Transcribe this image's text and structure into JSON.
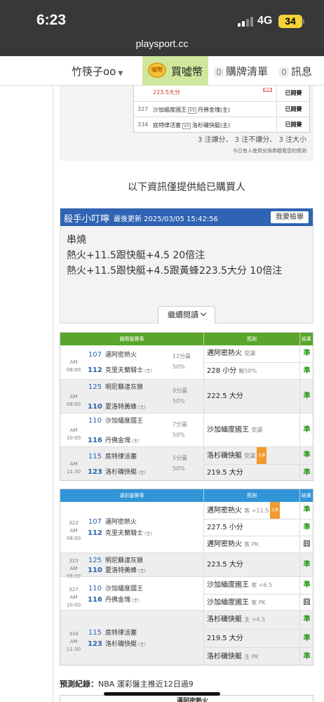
{
  "status": {
    "time": "6:23",
    "network": "4G",
    "battery": "34"
  },
  "url": "playsport.cc",
  "nav": {
    "username": "竹筷子oo",
    "coin_icon_text": "噓幣",
    "coin_label": "買噓幣",
    "cart_count": "0",
    "cart_label": "購牌清單",
    "msg_count": "0",
    "msg_label": "訊息"
  },
  "top_card": {
    "rows": [
      {
        "no": "",
        "teams": "223.5大分",
        "result": "已開賽",
        "red": true
      },
      {
        "no": "327",
        "home": "沙加緬度國王",
        "away": "丹佛金塊(主)",
        "result": "已開賽"
      },
      {
        "no": "334",
        "home": "底特律活塞",
        "away": "洛杉磯快艇(主)",
        "result": "已開賽"
      }
    ],
    "vs": "VS",
    "summary": "3 注讓分、 3 注不讓分、 3 注大小",
    "note": "今日有人使用兌換券觀看您的預測"
  },
  "notice": "以下資訊僅提供給已購買人",
  "killer": {
    "title": "殺手小叮嚀",
    "updated": "最後更新 2025/03/05 15:42:56",
    "report_btn": "我要檢舉",
    "lines": [
      "串燒",
      "熱火+11.5跟快艇+4.5 20倍注",
      "熱火+11.5跟快艇+4.5跟黃蜂223.5大分 10倍注"
    ],
    "more": "繼續閱讀"
  },
  "intl_table": {
    "headers": [
      "國際盤賽事",
      "預測",
      "結果"
    ],
    "games": [
      {
        "time": "AM 08:00",
        "away_no": "107",
        "away": "邁阿密熱火",
        "home_no": "112",
        "home": "克里夫蘭騎士",
        "odds1": "12分贏",
        "odds2": "50%",
        "picks": [
          {
            "text": "邁阿密熱火",
            "sub": "受讓",
            "result": "準"
          },
          {
            "text": "228 小分",
            "sub": "輸50%",
            "result": "準"
          }
        ]
      },
      {
        "time": "AM 08:00",
        "away_no": "125",
        "away": "明尼蘇達灰狼",
        "home_no": "110",
        "home": "夏洛特黃蜂",
        "odds1": "9分贏",
        "odds2": "50%",
        "picks": [
          {
            "text": "222.5 大分",
            "sub": "",
            "result": "準"
          }
        ]
      },
      {
        "time": "AM 10:00",
        "away_no": "110",
        "away": "沙加緬度國王",
        "home_no": "116",
        "home": "丹佛金塊",
        "odds1": "7分贏",
        "odds2": "50%",
        "picks": [
          {
            "text": "沙加緬度國王",
            "sub": "受讓",
            "result": "準"
          }
        ]
      },
      {
        "time": "AM 11:30",
        "away_no": "115",
        "away": "底特律活塞",
        "home_no": "123",
        "home": "洛杉磯快艇",
        "odds1": "5分贏",
        "odds2": "50%",
        "picks": [
          {
            "text": "洛杉磯快艇",
            "sub": "受讓",
            "tag": "主推",
            "result": "準"
          },
          {
            "text": "219.5 大分",
            "sub": "",
            "result": "準"
          }
        ]
      }
    ]
  },
  "lottery_table": {
    "headers": [
      "運彩盤賽事",
      "預測",
      "結果"
    ],
    "games": [
      {
        "no": "322",
        "time": "AM 08:00",
        "away_no": "107",
        "away": "邁阿密熱火",
        "home_no": "112",
        "home": "克里夫蘭騎士",
        "picks": [
          {
            "text": "邁阿密熱火",
            "sub": "客 +11.5",
            "tag": "主推",
            "result": "準"
          },
          {
            "text": "227.5 小分",
            "sub": "",
            "result": "準"
          },
          {
            "text": "邁阿密熱火",
            "sub": "客 PK",
            "result": "囧"
          }
        ]
      },
      {
        "no": "323",
        "time": "AM 08:00",
        "away_no": "125",
        "away": "明尼蘇達灰狼",
        "home_no": "110",
        "home": "夏洛特黃蜂",
        "picks": [
          {
            "text": "223.5 大分",
            "sub": "",
            "result": "準"
          }
        ]
      },
      {
        "no": "327",
        "time": "AM 10:00",
        "away_no": "110",
        "away": "沙加緬度國王",
        "home_no": "116",
        "home": "丹佛金塊",
        "picks": [
          {
            "text": "沙加緬度國王",
            "sub": "客 +6.5",
            "result": "準"
          },
          {
            "text": "沙加緬度國王",
            "sub": "客 PK",
            "result": "囧"
          }
        ]
      },
      {
        "no": "334",
        "time": "AM 11:30",
        "away_no": "115",
        "away": "底特律活塞",
        "home_no": "123",
        "home": "洛杉磯快艇",
        "picks": [
          {
            "text": "洛杉磯快艇",
            "sub": "主 +4.5",
            "result": "準"
          },
          {
            "text": "219.5 大分",
            "sub": "",
            "result": "準"
          },
          {
            "text": "洛杉磯快艇",
            "sub": "主 PK",
            "result": "準"
          }
        ]
      }
    ]
  },
  "home_marker": "(主)",
  "record": {
    "label": "預測紀錄：",
    "text": "NBA 運彩盤主推近12日過9"
  },
  "bottom_peek": {
    "text": "邁阿密熱火"
  }
}
